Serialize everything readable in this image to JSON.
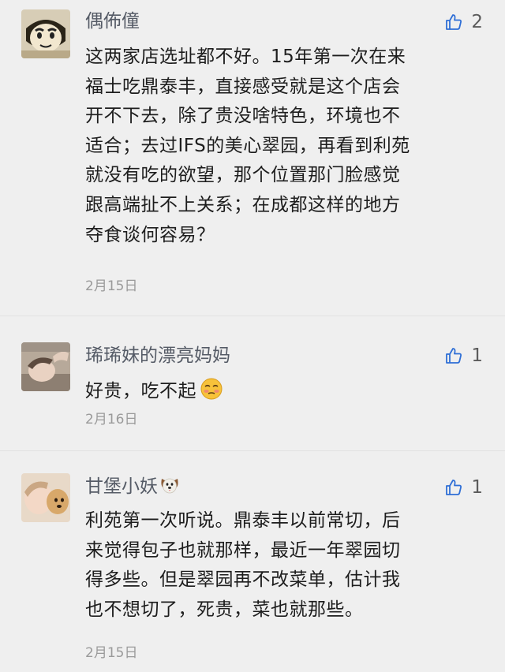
{
  "comments": [
    {
      "author": "偶佈僮",
      "avatar_icon": "cartoon-boy-avatar",
      "like_count": "2",
      "lines": [
        "这两家店选址都不好。15年第一次在来",
        "福士吃鼎泰丰，直接感受就是这个店会",
        "开不下去，除了贵没啥特色，环境也不",
        "适合；去过IFS的美心翠园，再看到利苑",
        "就没有吃的欲望，那个位置那门脸感觉",
        "跟高端扯不上关系；在成都这样的地方",
        "夺食谈何容易？"
      ],
      "date": "2月15日"
    },
    {
      "author": "琋琋妹的漂亮妈妈",
      "avatar_icon": "child-photo-avatar",
      "like_count": "1",
      "text": "好贵，吃不起",
      "emoji": "blushing-face-emoji",
      "date": "2月16日"
    },
    {
      "author": "甘堡小妖",
      "author_emoji": "dog-face-emoji",
      "avatar_icon": "child-with-dog-avatar",
      "like_count": "1",
      "lines": [
        "利苑第一次听说。鼎泰丰以前常切，后",
        "来觉得包子也就那样，最近一年翠园切",
        "得多些。但是翠园再不改菜单，估计我",
        "也不想切了，死贵，菜也就那些。"
      ],
      "date": "2月15日"
    }
  ],
  "colors": {
    "background": "#efefef",
    "author": "#555b66",
    "like_icon": "#2f6fd6",
    "date": "#9a9a9a"
  }
}
